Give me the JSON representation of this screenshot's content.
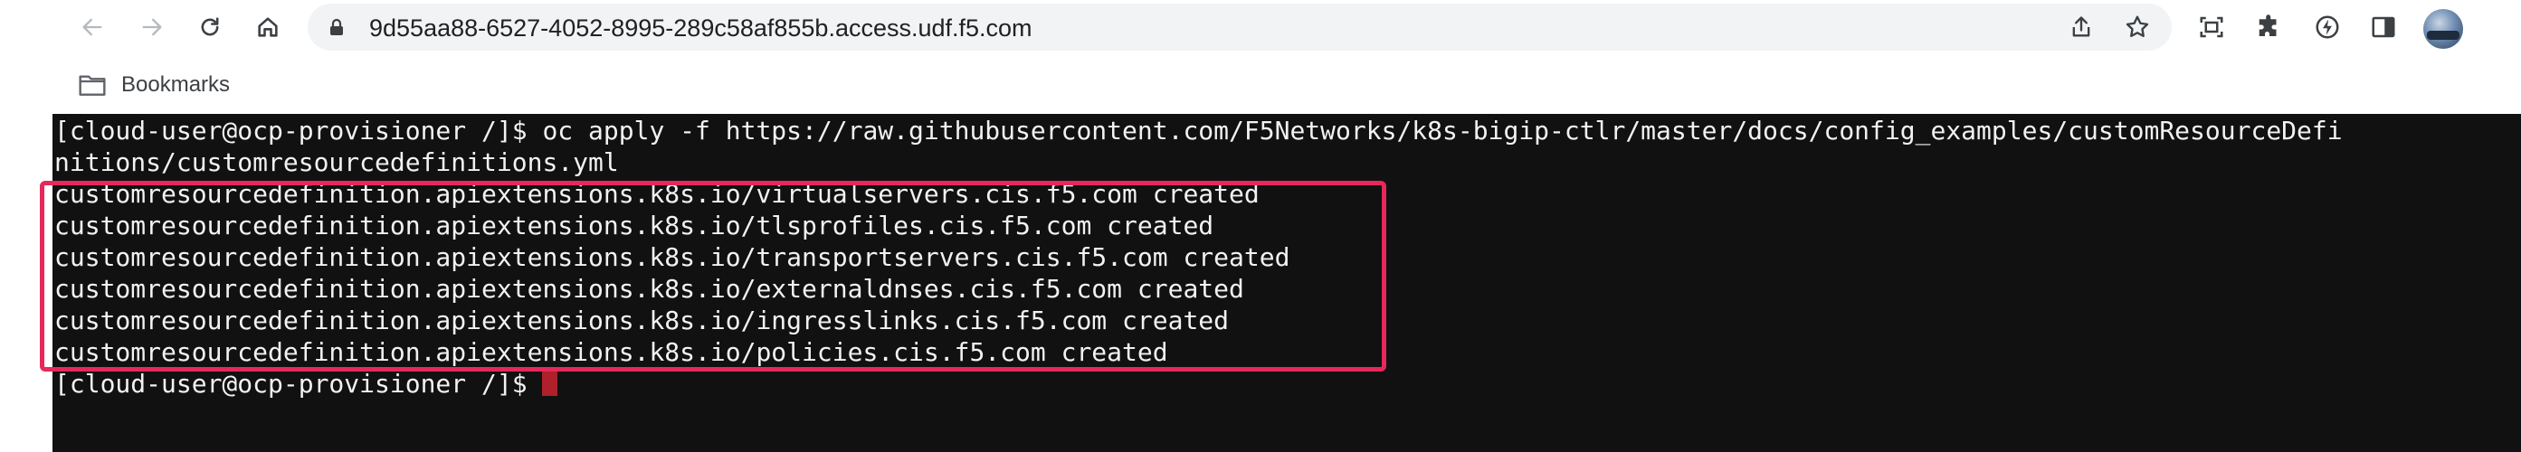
{
  "browser": {
    "url": "9d55aa88-6527-4052-8995-289c58af855b.access.udf.f5.com",
    "nav_icons": [
      "back-arrow-icon",
      "forward-arrow-icon",
      "reload-icon",
      "home-icon"
    ],
    "omnibox_icons": [
      "lock-icon",
      "share-icon",
      "bookmark-star-icon"
    ],
    "toolbar_icons": [
      "screenshot-icon",
      "extensions-puzzle-icon",
      "performance-icon",
      "side-panel-icon",
      "profile-avatar"
    ]
  },
  "bookmarks_bar": {
    "folder_label": "Bookmarks"
  },
  "terminal": {
    "lines": [
      "[cloud-user@ocp-provisioner /]$ oc apply -f https://raw.githubusercontent.com/F5Networks/k8s-bigip-ctlr/master/docs/config_examples/customResourceDefi",
      "nitions/customresourcedefinitions.yml",
      "customresourcedefinition.apiextensions.k8s.io/virtualservers.cis.f5.com created",
      "customresourcedefinition.apiextensions.k8s.io/tlsprofiles.cis.f5.com created",
      "customresourcedefinition.apiextensions.k8s.io/transportservers.cis.f5.com created",
      "customresourcedefinition.apiextensions.k8s.io/externaldnses.cis.f5.com created",
      "customresourcedefinition.apiextensions.k8s.io/ingresslinks.cis.f5.com created",
      "customresourcedefinition.apiextensions.k8s.io/policies.cis.f5.com created",
      "[cloud-user@ocp-provisioner /]$ "
    ]
  },
  "colors": {
    "terminal_bg": "#111111",
    "terminal_fg": "#f2f2f2",
    "highlight": "#e6285c",
    "cursor": "#b0202a",
    "omnibox_bg": "#f1f3f4"
  }
}
